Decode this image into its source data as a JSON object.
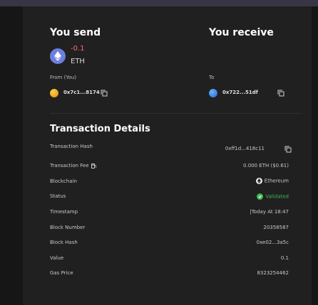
{
  "header": {
    "send_title": "You send",
    "receive_title": "You receive"
  },
  "send": {
    "amount": "-0.1",
    "symbol": "ETH",
    "token_icon": "ethereum-icon",
    "amount_color": "#ff6b6b"
  },
  "from": {
    "label": "From (You)",
    "address": "0x7c1...8174"
  },
  "to": {
    "label": "To",
    "address": "0x722...51df"
  },
  "details": {
    "title": "Transaction Details",
    "rows": [
      {
        "label": "Transaction Hash",
        "value": "0xff1d...418c11"
      },
      {
        "label": "Transaction Fee",
        "value": "0.000 ETH ($0.61)"
      },
      {
        "label": "Blockchain",
        "value": "Ethereum"
      },
      {
        "label": "Status",
        "value": "Validated"
      },
      {
        "label": "Timestamp",
        "value": "|Today At 18:47"
      },
      {
        "label": "Block Number",
        "value": "20358587"
      },
      {
        "label": "Block Hash",
        "value": "0xe02...3a5c"
      },
      {
        "label": "Value",
        "value": "0.1"
      },
      {
        "label": "Gas Price",
        "value": "8323254462"
      }
    ]
  },
  "colors": {
    "panel_bg": "#202020",
    "status_green": "#3fb950",
    "eth_blue": "#6b7fe0"
  }
}
